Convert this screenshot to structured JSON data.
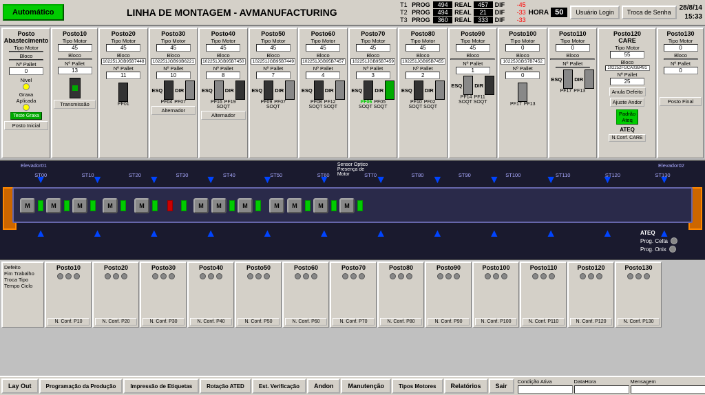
{
  "topbar": {
    "auto_label": "Automático",
    "title": "LINHA DE MONTAGEM - AVMANUFACTURING",
    "t1_label": "T1",
    "t2_label": "T2",
    "t3_label": "T3",
    "prog_label": "PROG",
    "real_label": "REAL",
    "dif_label": "DIF",
    "t1_prog": "494",
    "t1_real": "457",
    "t1_dif": "-45",
    "t2_prog": "494",
    "t2_real": "21",
    "t2_dif": "-33",
    "t3_prog": "360",
    "t3_real": "333",
    "t3_dif": "-33",
    "hora_label": "HORA",
    "hora_val": "50",
    "usuario_btn": "Usuário Login",
    "troca_btn": "Troca de Senha",
    "date": "28/8/14",
    "time": "15:33"
  },
  "postos_top": [
    {
      "id": "posto-abastecimento",
      "title": "Posto Abastecimento",
      "tipo_motor_label": "Tipo Motor",
      "tipo_motor_val": "",
      "bloco_label": "Bloco",
      "bloco_val": "",
      "pallet_label": "Nº Pallet",
      "pallet_val": "0",
      "nivel_label": "Nivel",
      "nivel_on": true,
      "graxa_label": "Graxa Aplicada",
      "teste_btn": "Teste Graxa",
      "bottom_btn": "Posto Inicial"
    },
    {
      "id": "posto10",
      "title": "Posto10",
      "tipo_motor_val": "45",
      "bloco_val": "",
      "pallet_label": "Nº Pallet",
      "pallet_val": "13",
      "has_sensor": true,
      "sensor_type": "transmissao",
      "bottom_btn": "Transmissão"
    },
    {
      "id": "posto20",
      "title": "Posto20",
      "tipo_motor_val": "45",
      "bloco_val": "102251JGB95B7448",
      "pallet_val": "11",
      "has_dir_esq": false,
      "pf_labels": [
        "PF01"
      ],
      "bottom_btn": null
    },
    {
      "id": "posto30",
      "title": "Posto30",
      "tipo_motor_val": "45",
      "bloco_val": "102251JGB93B6221",
      "pallet_val": "10",
      "dir": "DIR",
      "esq": "ESQ",
      "pf_labels": [
        "PF04",
        "PF07"
      ],
      "bottom_btn": null,
      "alternator_btn": "Alternador"
    },
    {
      "id": "posto40",
      "title": "Posto40",
      "tipo_motor_val": "45",
      "bloco_val": "102251JGB95B7450",
      "pallet_val": "8",
      "pf_labels": [
        "PF16",
        "PF19"
      ],
      "pf_sub": "SOQT",
      "bottom_btn": "Alternador"
    },
    {
      "id": "posto50",
      "title": "Posto50",
      "tipo_motor_val": "45",
      "bloco_val": "102251JGB95B7449",
      "pallet_val": "7",
      "pf_labels": [
        "PF09",
        "PF07"
      ],
      "pf_sub": "SOQT",
      "bottom_btn": null
    },
    {
      "id": "posto60",
      "title": "Posto60",
      "tipo_motor_val": "45",
      "bloco_val": "102251JGB95B7457",
      "pallet_val": "4",
      "pf_labels": [
        "PF08",
        "PF12"
      ],
      "pf_sub": "SOQT",
      "bottom_btn": null
    },
    {
      "id": "posto70",
      "title": "Posto70",
      "tipo_motor_val": "45",
      "bloco_val": "102251JGB95B7459",
      "pallet_val": "3",
      "pf_labels": [
        "PF06",
        "PF05"
      ],
      "pf_sub": "SOQT",
      "pf_color": "green",
      "bottom_btn": null
    },
    {
      "id": "posto80",
      "title": "Posto80",
      "tipo_motor_val": "45",
      "bloco_val": "102251JGB95B7455",
      "pallet_val": "2",
      "pf_labels": [
        "PF10",
        "PF02"
      ],
      "pf_sub": "SOQT",
      "bottom_btn": null
    },
    {
      "id": "posto90",
      "title": "Posto90",
      "tipo_motor_val": "45",
      "bloco_val": "",
      "pallet_val": "1",
      "pf_labels": [
        "PF14",
        "PF11"
      ],
      "pf_sub": "SOQT",
      "bottom_btn": null
    },
    {
      "id": "posto100",
      "title": "Posto100",
      "tipo_motor_val": "0",
      "bloco_val": "10225JGBS7B7452",
      "pallet_val": "0",
      "pf_labels": [
        "PF17",
        "PF13"
      ],
      "bottom_btn": null
    },
    {
      "id": "posto110",
      "title": "Posto110",
      "tipo_motor_val": "0",
      "bloco_val": "",
      "pallet_val": null,
      "pf_labels": [
        "PF17",
        "PF13"
      ],
      "bottom_btn": null
    },
    {
      "id": "posto120-care",
      "title": "Posto120 CARE",
      "tipo_motor_val": "55",
      "bloco_val": "102252FGCA03B491",
      "pallet_val": "25",
      "anula_btn": "Anula Defeito",
      "ajuste_btn": "Ajuste Andor",
      "padrao_btn": "Padrão Ateq",
      "nconf_btn": "N.Conf. CARE",
      "ateq_label": "ATEQ"
    },
    {
      "id": "posto130",
      "title": "Posto130",
      "tipo_motor_val": "0",
      "bloco_val": "",
      "pallet_val": "0",
      "bottom_btn": "Posto Final"
    }
  ],
  "conveyor": {
    "elevador01": "Elevador01",
    "elevador02": "Elevador02",
    "sensor_optico": "Sensor Optico Presença de Motor",
    "stations": [
      "ST00",
      "ST10",
      "ST20",
      "ST30",
      "ST40",
      "ST50",
      "ST60",
      "ST70",
      "ST80",
      "ST90",
      "ST100",
      "ST110",
      "ST120",
      "ST130"
    ],
    "ateq_label": "ATEQ",
    "prog_celta": "Prog. Celta",
    "prog_onix": "Prog. Onix"
  },
  "bottom_postos": [
    {
      "id": "info-panel",
      "labels": [
        "Defeito",
        "Fim Trabalho",
        "Troca Tipo",
        "Tempo Ciclo"
      ]
    },
    {
      "id": "bp-posto10",
      "title": "Posto10",
      "dots": 3,
      "btn": "N. Conf. P10"
    },
    {
      "id": "bp-posto20",
      "title": "Posto20",
      "dots": 3,
      "btn": "N. Conf. P20"
    },
    {
      "id": "bp-posto30",
      "title": "Posto30",
      "dots": 3,
      "btn": "N. Conf. P30"
    },
    {
      "id": "bp-posto40",
      "title": "Posto40",
      "dots": 3,
      "btn": "N. Conf. P40"
    },
    {
      "id": "bp-posto50",
      "title": "Posto50",
      "dots": 3,
      "btn": "N. Conf. P50"
    },
    {
      "id": "bp-posto60",
      "title": "Posto60",
      "dots": 3,
      "btn": "N. Conf. P60"
    },
    {
      "id": "bp-posto70",
      "title": "Posto70",
      "dots": 3,
      "btn": "N. Conf. P70"
    },
    {
      "id": "bp-posto80",
      "title": "Posto80",
      "dots": 3,
      "btn": "N. Conf. P80"
    },
    {
      "id": "bp-posto90",
      "title": "Posto90",
      "dots": 3,
      "btn": "N. Conf. P90"
    },
    {
      "id": "bp-posto100",
      "title": "Posto100",
      "dots": 3,
      "btn": "N. Conf. P100"
    },
    {
      "id": "bp-posto110",
      "title": "Posto110",
      "dots": 3,
      "btn": "N. Conf. P110"
    },
    {
      "id": "bp-posto120",
      "title": "Posto120",
      "dots": 3,
      "btn": "N. Conf. P120"
    },
    {
      "id": "bp-posto130",
      "title": "Posto130",
      "dots": 3,
      "btn": "N. Conf. P130"
    }
  ],
  "nav": {
    "lay_out": "Lay Out",
    "programacao": "Programação da Produção",
    "impressao": "Impressão de Etiquetas",
    "rotacao": "Rotação ATED",
    "est_verificacao": "Est. Verificação",
    "andon": "Andon",
    "manutencao": "Manutenção",
    "tipos_motores": "Tipos Motores",
    "relatorios": "Relatórios",
    "sair": "Sair",
    "condicao_ativa": "Condição Ativa",
    "dataHora": "DataHora",
    "mensagem": "Mensagem"
  }
}
